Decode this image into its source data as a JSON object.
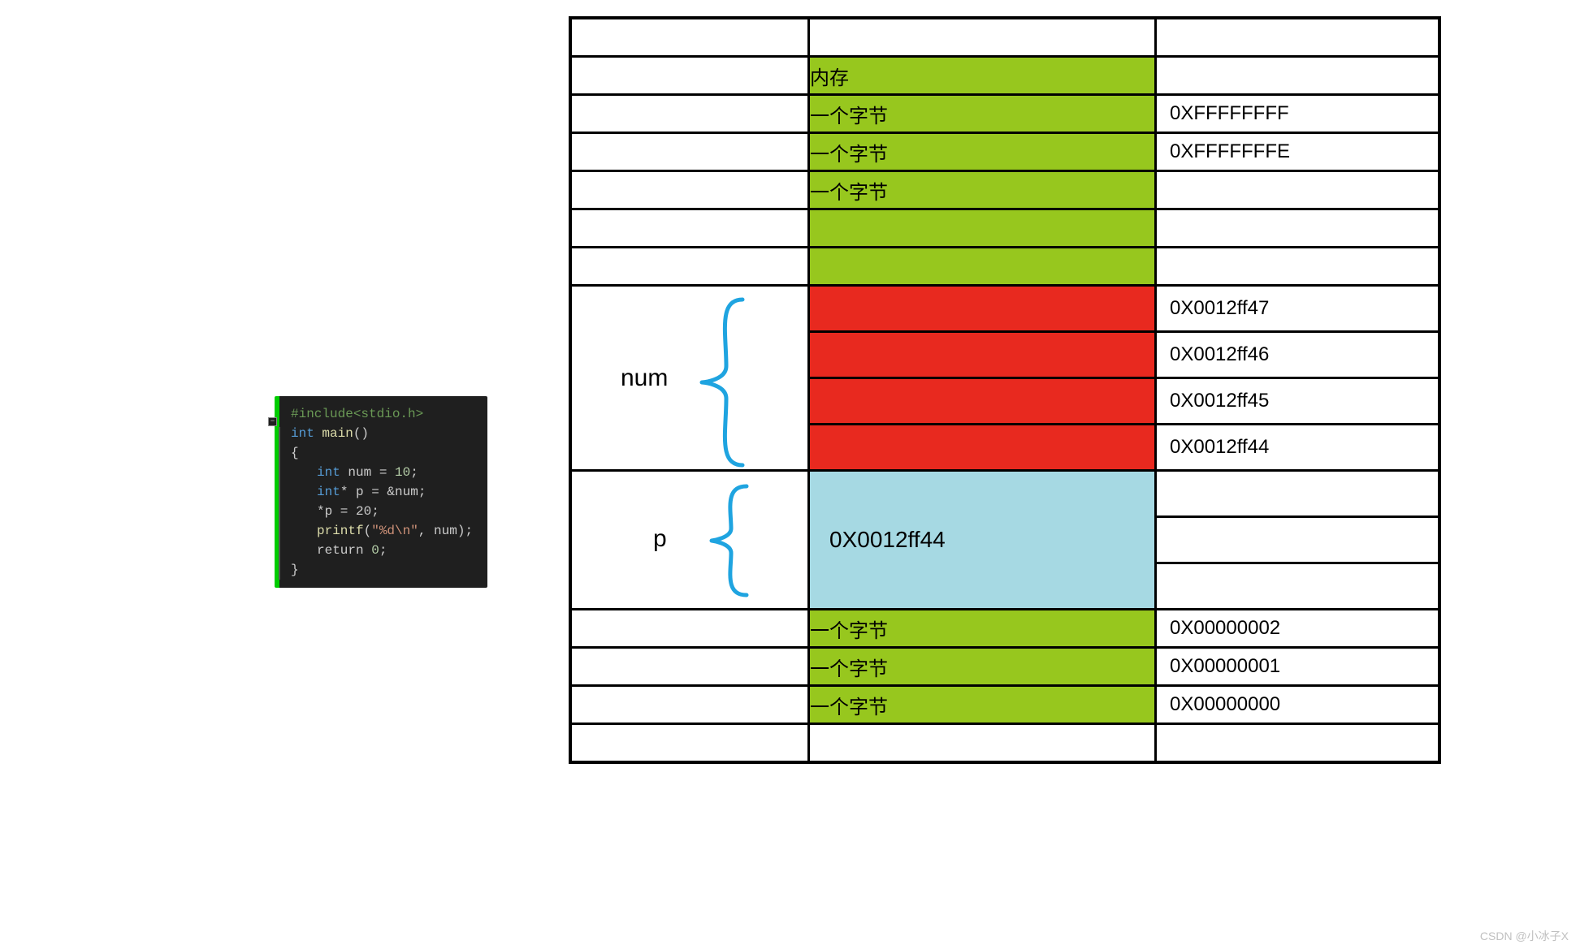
{
  "code": {
    "l1": "#include<stdio.h>",
    "l2_a": "int",
    "l2_b": " main",
    "l2_c": "()",
    "l3": "{",
    "l4_a": "int",
    "l4_b": " num = ",
    "l4_c": "10",
    "l4_d": ";",
    "l5_a": "int",
    "l5_b": "* p = &num;",
    "l6": "*p = 20;",
    "l7": "",
    "l8_a": "printf",
    "l8_b": "(",
    "l8_c": "\"%d\\n\"",
    "l8_d": ", num);",
    "l9_a": "return ",
    "l9_b": "0",
    "l9_c": ";",
    "l10": "}"
  },
  "cells": {
    "mem_header": "内存",
    "byte": "一个字节",
    "addr_ffffffff": "0XFFFFFFFF",
    "addr_fffffffe": "0XFFFFFFFE",
    "addr_0012ff47": "0X0012ff47",
    "addr_0012ff46": "0X0012ff46",
    "addr_0012ff45": "0X0012ff45",
    "addr_0012ff44": "0X0012ff44",
    "p_value": "0X0012ff44",
    "addr_00000002": "0X00000002",
    "addr_00000001": "0X00000001",
    "addr_00000000": "0X00000000"
  },
  "labels": {
    "num": "num",
    "p": "p"
  },
  "watermark": "CSDN @小冰子X"
}
